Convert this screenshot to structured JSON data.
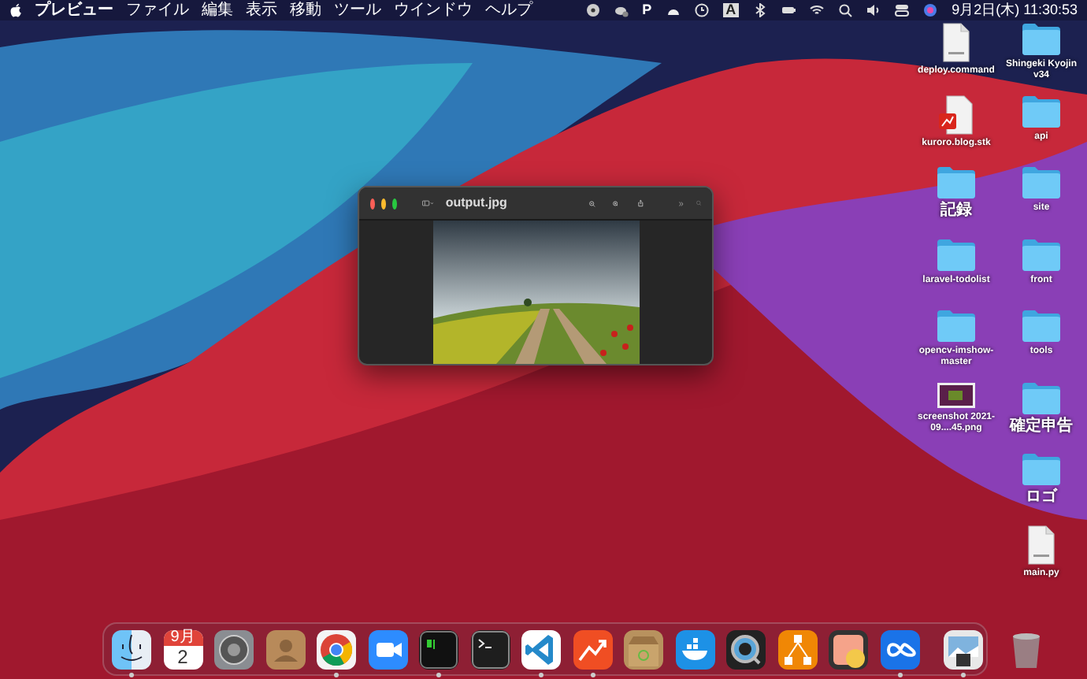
{
  "menu_bar": {
    "app_name": "プレビュー",
    "menus": [
      "ファイル",
      "編集",
      "表示",
      "移動",
      "ツール",
      "ウインドウ",
      "ヘルプ"
    ],
    "status_items": [
      {
        "kind": "disc"
      },
      {
        "kind": "cloud-gear"
      },
      {
        "kind": "letter",
        "text": "P"
      },
      {
        "kind": "cloud"
      },
      {
        "kind": "clock"
      },
      {
        "kind": "input",
        "text": "A"
      },
      {
        "kind": "bluetooth"
      },
      {
        "kind": "battery"
      },
      {
        "kind": "wifi"
      },
      {
        "kind": "search"
      },
      {
        "kind": "volume"
      },
      {
        "kind": "control"
      },
      {
        "kind": "siri"
      }
    ],
    "clock": "9月2日(木) 11:30:53"
  },
  "desktop": {
    "columns": [
      [
        {
          "label": "deploy.command",
          "kind": "document"
        },
        {
          "label": "kuroro.blog.stk",
          "kind": "stk"
        },
        {
          "label": "記録",
          "kind": "folder"
        },
        {
          "label": "laravel-todolist",
          "kind": "folder"
        },
        {
          "label": "opencv-imshow-master",
          "kind": "folder"
        },
        {
          "label": "screenshot 2021-09....45.png",
          "kind": "image"
        }
      ],
      [
        {
          "label": "Shingeki Kyojin v34",
          "kind": "folder"
        },
        {
          "label": "api",
          "kind": "folder"
        },
        {
          "label": "site",
          "kind": "folder"
        },
        {
          "label": "front",
          "kind": "folder"
        },
        {
          "label": "tools",
          "kind": "folder"
        },
        {
          "label": "確定申告",
          "kind": "folder"
        },
        {
          "label": "ロゴ",
          "kind": "folder"
        },
        {
          "label": "main.py",
          "kind": "document"
        }
      ]
    ]
  },
  "window": {
    "title": "output.jpg"
  },
  "dock": {
    "apps": [
      {
        "kind": "finder",
        "running": true
      },
      {
        "kind": "calendar",
        "running": false,
        "month": "9月",
        "day": "2"
      },
      {
        "kind": "settings",
        "running": false
      },
      {
        "kind": "contacts",
        "running": false
      },
      {
        "kind": "chrome",
        "running": true
      },
      {
        "kind": "zoom",
        "running": false
      },
      {
        "kind": "iterm",
        "running": true
      },
      {
        "kind": "terminal",
        "running": false
      },
      {
        "kind": "vscode",
        "running": true
      },
      {
        "kind": "chart",
        "running": true
      },
      {
        "kind": "box",
        "running": false
      },
      {
        "kind": "docker",
        "running": false
      },
      {
        "kind": "lens",
        "running": false
      },
      {
        "kind": "diagram",
        "running": false
      },
      {
        "kind": "pill",
        "running": false
      },
      {
        "kind": "infinity",
        "running": true
      }
    ],
    "recent": [
      {
        "kind": "photo",
        "running": true
      }
    ],
    "trash": {
      "kind": "trash"
    }
  }
}
